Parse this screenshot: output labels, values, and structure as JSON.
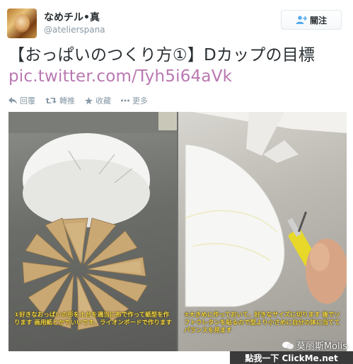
{
  "header": {
    "display_name": "なめチル•真",
    "handle": "@atelierspana",
    "follow_label": "關注",
    "follow_icon": "add-person-icon"
  },
  "tweet": {
    "text": "【おっぱいのつくり方①】Dカップの目標",
    "link": "pic.twitter.com/Tyh5i64aVk"
  },
  "actions": [
    {
      "label": "回覆",
      "icon": "reply-icon"
    },
    {
      "label": "轉推",
      "icon": "retweet-icon"
    },
    {
      "label": "收藏",
      "icon": "favorite-star-icon"
    },
    {
      "label": "更多",
      "icon": "more-dots-icon"
    }
  ],
  "photo": {
    "left_caption": "①好きなおっぱいの形を土台を適当に布で作って紙型を作ります 画用紙とかでいいです、ライオンボードで作ります",
    "right_caption": "②大きめに作っておいて、好きなサイズに切ります 後でソフトウレタンを貼るので型より小さめに自分の体に当ててバランスを見ます"
  },
  "watermark": {
    "brand": "莫丽斯Molis",
    "cta": "點我一下 ClickMe.net"
  },
  "colors": {
    "link": "#b978b2",
    "text": "#292f33",
    "muted": "#8899a6",
    "caption": "#f5d94a"
  }
}
